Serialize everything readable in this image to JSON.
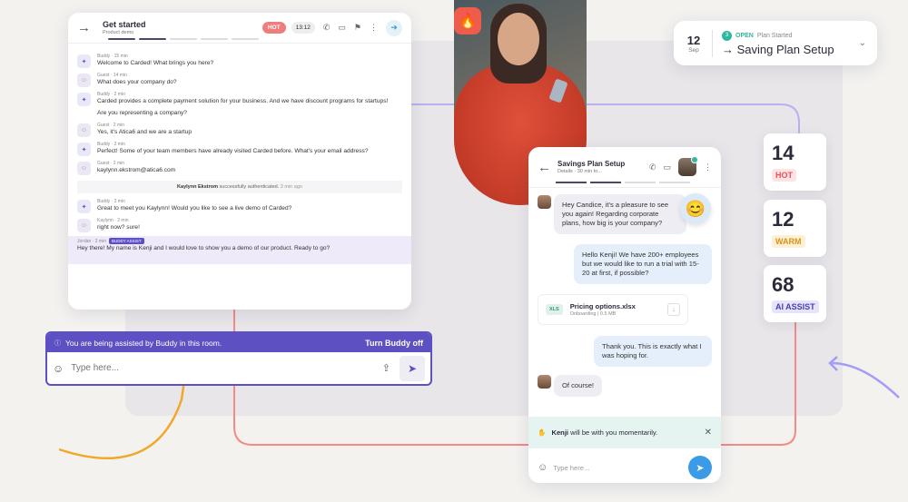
{
  "main_chat": {
    "title": "Get started",
    "subtitle": "Product demo",
    "hot_label": "HOT",
    "timer": "13:12",
    "messages": [
      {
        "sender": "Buddy",
        "time": "15 min",
        "text": "Welcome to Carded! What brings you here?"
      },
      {
        "sender": "Guest",
        "time": "14 min",
        "text": "What does your company do?"
      },
      {
        "sender": "Buddy",
        "time": "2 min",
        "text": "Carded provides a complete payment solution for your business. And we have discount programs for startups!"
      },
      {
        "sender": "",
        "time": "",
        "text": "Are you representing a company?"
      },
      {
        "sender": "Guest",
        "time": "2 min",
        "text": "Yes, it's Atica6 and we are a startup"
      },
      {
        "sender": "Buddy",
        "time": "2 min",
        "text": "Perfect! Some of your team members have already visited Carded before. What's your email address?"
      },
      {
        "sender": "Guest",
        "time": "2 min",
        "text": "kaylynn.ekstrom@atica6.com"
      }
    ],
    "system": {
      "name": "Kaylynn Ekstrom",
      "text": "successfully authenticated.",
      "time": "3 min ago"
    },
    "messages2": [
      {
        "sender": "Buddy",
        "time": "2 min",
        "text": "Great to meet you Kaylynn! Would you like to see a live demo of Carded?"
      },
      {
        "sender": "Kaylynn",
        "time": "2 min",
        "text": "right now? sure!"
      }
    ],
    "jordan": {
      "sender": "Jordan",
      "time": "2 min",
      "badge": "BUDDY ASSIST",
      "text": "Hey there! My name is Kenji and I would love to show you a demo of our product. Ready to go?"
    }
  },
  "assist": {
    "banner": "You are being assisted by Buddy in this room.",
    "turn_off": "Turn Buddy off",
    "placeholder": "Type here..."
  },
  "plan": {
    "day": "12",
    "month": "Sep",
    "count": "3",
    "status": "OPEN",
    "status_sub": "Plan Started",
    "title": "Saving Plan Setup"
  },
  "stats": [
    {
      "value": "14",
      "label": "HOT",
      "color": "#e8505b",
      "bg": "#fde4e4"
    },
    {
      "value": "12",
      "label": "WARM",
      "color": "#d9931b",
      "bg": "#fdf0d4"
    },
    {
      "value": "68",
      "label": "AI ASSIST",
      "color": "#4a3fb8",
      "bg": "#e6e4f8"
    }
  ],
  "mobile": {
    "title": "Savings Plan Setup",
    "subtitle": "Details · 30 min to...",
    "msg1": "Hey Candice, it's a pleasure to see you again! Regarding corporate plans, how big is your company?",
    "msg2": "Hello Kenji! We have 200+ employees but we would like to run a trial with 15-20 at first, if possible?",
    "file_type": "XLS",
    "file_name": "Pricing options.xlsx",
    "file_meta": "Onboarding | 0.5 MB",
    "msg3": "Thank you. This is exactly what I was hoping for.",
    "msg4": "Of course!",
    "notice_name": "Kenji",
    "notice_text": "will be with you momentarily.",
    "placeholder": "Type here..."
  }
}
